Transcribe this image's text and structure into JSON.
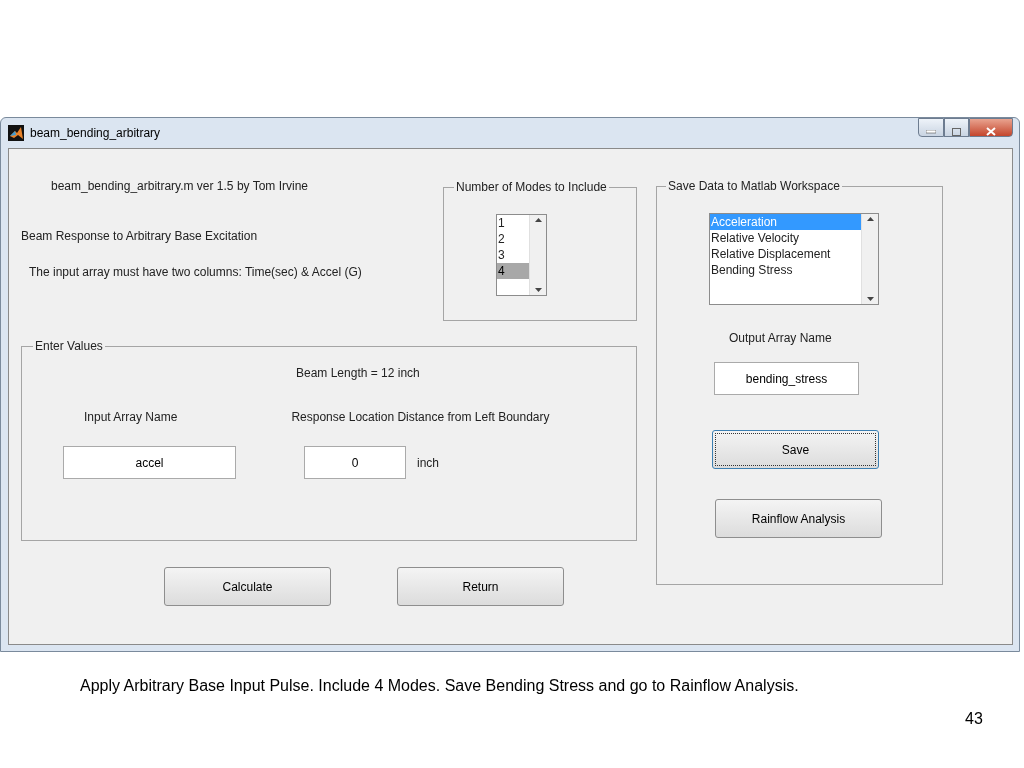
{
  "window": {
    "title": "beam_bending_arbitrary"
  },
  "info_texts": [
    "beam_bending_arbitrary.m  ver 1.5  by Tom Irvine",
    "Beam Response to Arbitrary Base Excitation",
    "The input array must have two columns:  Time(sec) & Accel (G)"
  ],
  "modes_group": {
    "title": "Number of Modes to Include",
    "listbox": {
      "focused": false,
      "items": [
        {
          "label": "1",
          "selected": false
        },
        {
          "label": "2",
          "selected": false
        },
        {
          "label": "3",
          "selected": false
        },
        {
          "label": "4",
          "selected": true
        }
      ]
    }
  },
  "enter_values": {
    "title": "Enter Values",
    "beam_length": "Beam Length = 12 inch",
    "input_label": "Input Array Name",
    "input_value": "accel",
    "location_label": "Response Location Distance from Left Boundary",
    "location_value": "0",
    "location_unit": "inch"
  },
  "buttons": [
    {
      "label": "Calculate",
      "focused": false
    },
    {
      "label": "Return",
      "focused": false
    }
  ],
  "save_group": {
    "title": "Save Data to Matlab Workspace",
    "listbox": {
      "focused": true,
      "items": [
        {
          "label": "Acceleration",
          "selected": true
        },
        {
          "label": "Relative Velocity",
          "selected": false
        },
        {
          "label": "Relative Displacement",
          "selected": false
        },
        {
          "label": "Bending Stress",
          "selected": false
        }
      ]
    },
    "output_label": "Output Array Name",
    "output_value": "bending_stress",
    "buttons": [
      {
        "label": "Save",
        "focused": true
      },
      {
        "label": "Rainflow Analysis",
        "focused": false
      }
    ]
  },
  "caption": "Apply Arbitrary Base Input Pulse.   Include 4 Modes.   Save Bending Stress and go to Rainflow Analysis.",
  "slide_number": "43"
}
